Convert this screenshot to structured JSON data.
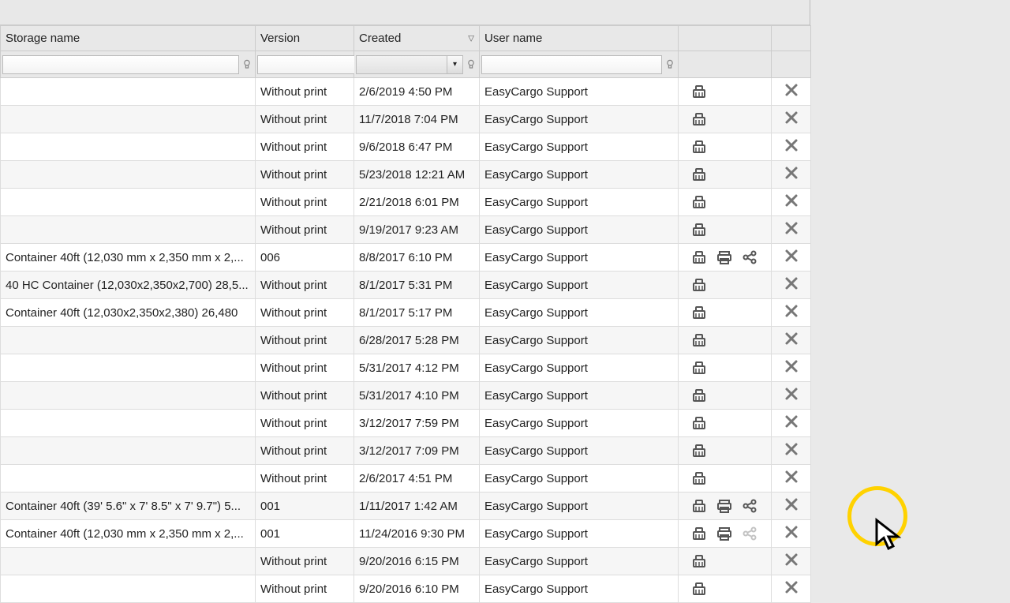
{
  "columns": {
    "storage": "Storage name",
    "version": "Version",
    "created": "Created",
    "user": "User name"
  },
  "sort_indicator": "▽",
  "filters": {
    "storage": "",
    "version": "",
    "created": "",
    "user": ""
  },
  "rows": [
    {
      "storage": "",
      "version": "Without print",
      "created": "2/6/2019 4:50 PM",
      "user": "EasyCargo Support",
      "print": false,
      "share": false
    },
    {
      "storage": "",
      "version": "Without print",
      "created": "11/7/2018 7:04 PM",
      "user": "EasyCargo Support",
      "print": false,
      "share": false
    },
    {
      "storage": "",
      "version": "Without print",
      "created": "9/6/2018 6:47 PM",
      "user": "EasyCargo Support",
      "print": false,
      "share": false
    },
    {
      "storage": "",
      "version": "Without print",
      "created": "5/23/2018 12:21 AM",
      "user": "EasyCargo Support",
      "print": false,
      "share": false
    },
    {
      "storage": "",
      "version": "Without print",
      "created": "2/21/2018 6:01 PM",
      "user": "EasyCargo Support",
      "print": false,
      "share": false
    },
    {
      "storage": "",
      "version": "Without print",
      "created": "9/19/2017 9:23 AM",
      "user": "EasyCargo Support",
      "print": false,
      "share": false
    },
    {
      "storage": "Container 40ft (12,030 mm x 2,350 mm x 2,...",
      "version": "006",
      "created": "8/8/2017 6:10 PM",
      "user": "EasyCargo Support",
      "print": true,
      "share": true
    },
    {
      "storage": "40 HC Container (12,030x2,350x2,700) 28,5...",
      "version": "Without print",
      "created": "8/1/2017 5:31 PM",
      "user": "EasyCargo Support",
      "print": false,
      "share": false
    },
    {
      "storage": "Container 40ft (12,030x2,350x2,380) 26,480",
      "version": "Without print",
      "created": "8/1/2017 5:17 PM",
      "user": "EasyCargo Support",
      "print": false,
      "share": false
    },
    {
      "storage": "",
      "version": "Without print",
      "created": "6/28/2017 5:28 PM",
      "user": "EasyCargo Support",
      "print": false,
      "share": false
    },
    {
      "storage": "",
      "version": "Without print",
      "created": "5/31/2017 4:12 PM",
      "user": "EasyCargo Support",
      "print": false,
      "share": false
    },
    {
      "storage": "",
      "version": "Without print",
      "created": "5/31/2017 4:10 PM",
      "user": "EasyCargo Support",
      "print": false,
      "share": false
    },
    {
      "storage": "",
      "version": "Without print",
      "created": "3/12/2017 7:59 PM",
      "user": "EasyCargo Support",
      "print": false,
      "share": false
    },
    {
      "storage": "",
      "version": "Without print",
      "created": "3/12/2017 7:09 PM",
      "user": "EasyCargo Support",
      "print": false,
      "share": false
    },
    {
      "storage": "",
      "version": "Without print",
      "created": "2/6/2017 4:51 PM",
      "user": "EasyCargo Support",
      "print": false,
      "share": false
    },
    {
      "storage": "Container 40ft (39' 5.6\" x 7' 8.5\" x 7' 9.7\") 5...",
      "version": "001",
      "created": "1/11/2017 1:42 AM",
      "user": "EasyCargo Support",
      "print": true,
      "share": true
    },
    {
      "storage": "Container 40ft (12,030 mm x 2,350 mm x 2,...",
      "version": "001",
      "created": "11/24/2016 9:30 PM",
      "user": "EasyCargo Support",
      "print": true,
      "share": true,
      "share_dim": true
    },
    {
      "storage": "",
      "version": "Without print",
      "created": "9/20/2016 6:15 PM",
      "user": "EasyCargo Support",
      "print": false,
      "share": false
    },
    {
      "storage": "",
      "version": "Without print",
      "created": "9/20/2016 6:10 PM",
      "user": "EasyCargo Support",
      "print": false,
      "share": false
    }
  ]
}
